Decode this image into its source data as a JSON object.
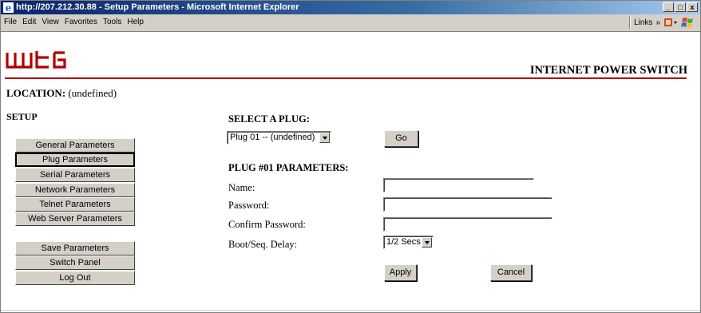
{
  "window": {
    "title": "http://207.212.30.88 - Setup Parameters - Microsoft Internet Explorer",
    "controls": {
      "minimize": "_",
      "maximize": "□",
      "close": "x"
    }
  },
  "menubar": {
    "items": [
      "File",
      "Edit",
      "View",
      "Favorites",
      "Tools",
      "Help"
    ],
    "links_label": "Links",
    "links_chevron": "»"
  },
  "header": {
    "logo_text": "wti",
    "product_name": "INTERNET POWER SWITCH",
    "accent_color": "#b00000"
  },
  "location": {
    "label": "LOCATION:",
    "value": "(undefined)"
  },
  "sidebar": {
    "heading": "SETUP",
    "items": [
      {
        "label": "General Parameters",
        "active": false
      },
      {
        "label": "Plug Parameters",
        "active": true
      },
      {
        "label": "Serial Parameters",
        "active": false
      },
      {
        "label": "Network Parameters",
        "active": false
      },
      {
        "label": "Telnet Parameters",
        "active": false
      },
      {
        "label": "Web Server Parameters",
        "active": false
      }
    ],
    "actions": [
      {
        "label": "Save Parameters"
      },
      {
        "label": "Switch Panel"
      },
      {
        "label": "Log Out"
      }
    ]
  },
  "main": {
    "select_plug_heading": "SELECT A PLUG:",
    "plug_select_value": "Plug 01 -- (undefined)",
    "go_label": "Go",
    "params_heading": "PLUG #01 PARAMETERS:",
    "fields": {
      "name_label": "Name:",
      "name_value": "",
      "password_label": "Password:",
      "password_value": "",
      "confirm_label": "Confirm Password:",
      "confirm_value": "",
      "delay_label": "Boot/Seq. Delay:",
      "delay_value": "1/2 Secs"
    },
    "apply_label": "Apply",
    "cancel_label": "Cancel"
  }
}
